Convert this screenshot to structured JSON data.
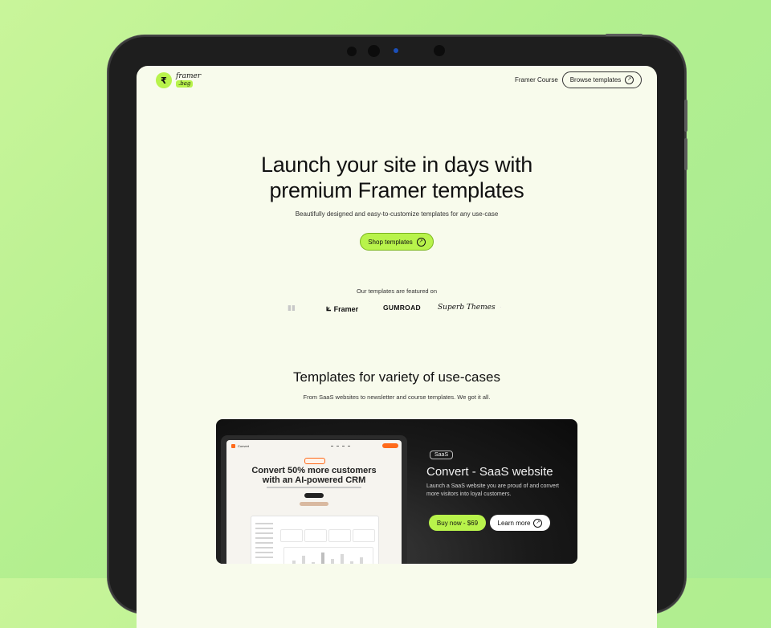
{
  "header": {
    "logo_text": "framer",
    "logo_tag": ".bag",
    "nav_link": "Framer Course",
    "browse_button": "Browse templates"
  },
  "hero": {
    "title_line1": "Launch your site in days with",
    "title_line2": "premium Framer templates",
    "subtitle": "Beautifully designed and easy-to-customize templates for any use-case",
    "cta": "Shop templates"
  },
  "featured": {
    "label": "Our templates are featured on",
    "partners": [
      "Framer",
      "GUMROAD",
      "Superb Themes"
    ]
  },
  "use_cases": {
    "title": "Templates for variety of use-cases",
    "subtitle": "From SaaS websites to newsletter and course templates. We got it all."
  },
  "template_card": {
    "badge": "SaaS",
    "title": "Convert - SaaS website",
    "description": "Launch a SaaS website you are proud of and convert more visitors into loyal customers.",
    "buy_button": "Buy now - $69",
    "learn_button": "Learn more",
    "preview": {
      "brand": "Convert",
      "headline_line1": "Convert 50% more customers",
      "headline_line2": "with an AI-powered CRM"
    }
  },
  "colors": {
    "accent": "#b8f34b",
    "background_gradient": [
      "#c9f59a",
      "#a6ea95"
    ],
    "screen_bg": "#f8fbec",
    "card_dark": "#111111"
  }
}
